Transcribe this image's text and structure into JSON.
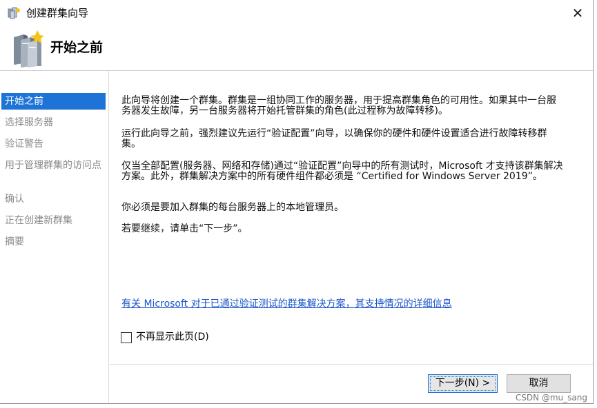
{
  "window": {
    "title": "创建群集向导",
    "close_glyph": "✕"
  },
  "header": {
    "title": "开始之前",
    "icon": "cluster-servers-icon"
  },
  "nav": {
    "items": [
      {
        "label": "开始之前",
        "active": true
      },
      {
        "label": "选择服务器"
      },
      {
        "label": "验证警告"
      },
      {
        "label": "用于管理群集的访问点"
      },
      {
        "label": "确认"
      },
      {
        "label": "正在创建新群集"
      },
      {
        "label": "摘要"
      }
    ]
  },
  "content": {
    "paragraphs": [
      "此向导将创建一个群集。群集是一组协同工作的服务器，用于提高群集角色的可用性。如果其中一台服务器发生故障，另一台服务器将开始托管群集的角色(此过程称为故障转移)。",
      "运行此向导之前，强烈建议先运行“验证配置”向导，以确保你的硬件和硬件设置适合进行故障转移群集。",
      "仅当全部配置(服务器、网络和存储)通过“验证配置”向导中的所有测试时，Microsoft 才支持该群集解决方案。此外，群集解决方案中的所有硬件组件都必须是 “Certified for Windows Server 2019”。",
      "你必须是要加入群集的每台服务器上的本地管理员。",
      "若要继续，请单击“下一步”。"
    ],
    "link": "有关 Microsoft 对于已通过验证测试的群集解决方案，其支持情况的详细信息",
    "checkbox_label": "不再显示此页(D)",
    "checkbox_checked": false
  },
  "footer": {
    "next_label": "下一步(N) >",
    "cancel_label": "取消"
  },
  "watermark": "CSDN @mu_sang",
  "colors": {
    "accent": "#1e74d6",
    "link": "#1a55c9",
    "nav_inactive": "#8a8a8a"
  }
}
